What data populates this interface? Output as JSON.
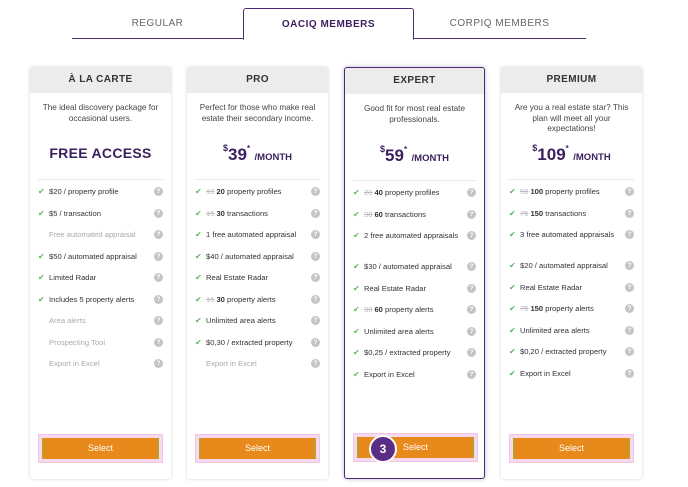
{
  "tabs": [
    {
      "label": "REGULAR"
    },
    {
      "label": "OACIQ MEMBERS"
    },
    {
      "label": "CORPIQ MEMBERS"
    }
  ],
  "plans": [
    {
      "name": "À LA CARTE",
      "desc": "The ideal discovery package for occasional users.",
      "price_text": "FREE ACCESS",
      "features": [
        {
          "text": "$20 / property profile",
          "on": true
        },
        {
          "text": "$5 / transaction",
          "on": true
        },
        {
          "text": "Free automated appraisal",
          "on": false
        },
        {
          "text": "$50 / automated appraisal",
          "on": true
        },
        {
          "text": "Limited Radar",
          "on": true
        },
        {
          "text": "Includes 5 property alerts",
          "on": true
        },
        {
          "text": "Area alerts",
          "on": false
        },
        {
          "text": "Prospecting Tool",
          "on": false
        },
        {
          "text": "Export in Excel",
          "on": false
        }
      ],
      "button": "Select"
    },
    {
      "name": "PRO",
      "desc": "Perfect for those who make real estate their secondary income.",
      "price": {
        "currency": "$",
        "amount": "39",
        "sup": "*",
        "per": "/MONTH"
      },
      "features": [
        {
          "strike": "10",
          "bold": "20",
          "text": "property profiles",
          "on": true
        },
        {
          "strike": "15",
          "bold": "30",
          "text": "transactions",
          "on": true
        },
        {
          "text": "1 free automated appraisal",
          "on": true
        },
        {
          "text": "$40 / automated appraisal",
          "on": true
        },
        {
          "text": "Real Estate Radar",
          "on": true
        },
        {
          "strike": "15",
          "bold": "30",
          "text": "property alerts",
          "on": true
        },
        {
          "text": "Unlimited area alerts",
          "on": true
        },
        {
          "text": "$0,30 / extracted property",
          "on": true
        },
        {
          "text": "Export in Excel",
          "on": false
        }
      ],
      "button": "Select"
    },
    {
      "name": "EXPERT",
      "desc": "Good fit for most real estate professionals.",
      "price": {
        "currency": "$",
        "amount": "59",
        "sup": "*",
        "per": "/MONTH"
      },
      "features": [
        {
          "strike": "20",
          "bold": "40",
          "text": "property profiles",
          "on": true
        },
        {
          "strike": "30",
          "bold": "60",
          "text": "transactions",
          "on": true
        },
        {
          "text": "2 free automated appraisals",
          "on": true,
          "tall": true
        },
        {
          "text": "$30 / automated appraisal",
          "on": true
        },
        {
          "text": "Real Estate Radar",
          "on": true
        },
        {
          "strike": "30",
          "bold": "60",
          "text": "property alerts",
          "on": true
        },
        {
          "text": "Unlimited area alerts",
          "on": true
        },
        {
          "text": "$0,25 / extracted property",
          "on": true
        },
        {
          "text": "Export in Excel",
          "on": true
        }
      ],
      "button": "Select",
      "badge": "3"
    },
    {
      "name": "PREMIUM",
      "desc": "Are you a real estate star? This plan will meet all your expectations!",
      "price": {
        "currency": "$",
        "amount": "109",
        "sup": "*",
        "per": "/MONTH"
      },
      "features": [
        {
          "strike": "50",
          "bold": "100",
          "text": "property profiles",
          "on": true
        },
        {
          "strike": "75",
          "bold": "150",
          "text": "transactions",
          "on": true
        },
        {
          "text": "3 free automated appraisals",
          "on": true,
          "tall": true
        },
        {
          "text": "$20 / automated appraisal",
          "on": true
        },
        {
          "text": "Real Estate Radar",
          "on": true
        },
        {
          "strike": "75",
          "bold": "150",
          "text": "property alerts",
          "on": true
        },
        {
          "text": "Unlimited area alerts",
          "on": true
        },
        {
          "text": "$0,20 / extracted property",
          "on": true
        },
        {
          "text": "Export in Excel",
          "on": true
        }
      ],
      "button": "Select"
    }
  ],
  "icons": {
    "check": "check-icon",
    "help": "help-icon"
  },
  "colors": {
    "accent": "#3a1f5e",
    "button": "#e8891b",
    "check": "#5cb85c",
    "badge": "#5b2d84"
  }
}
